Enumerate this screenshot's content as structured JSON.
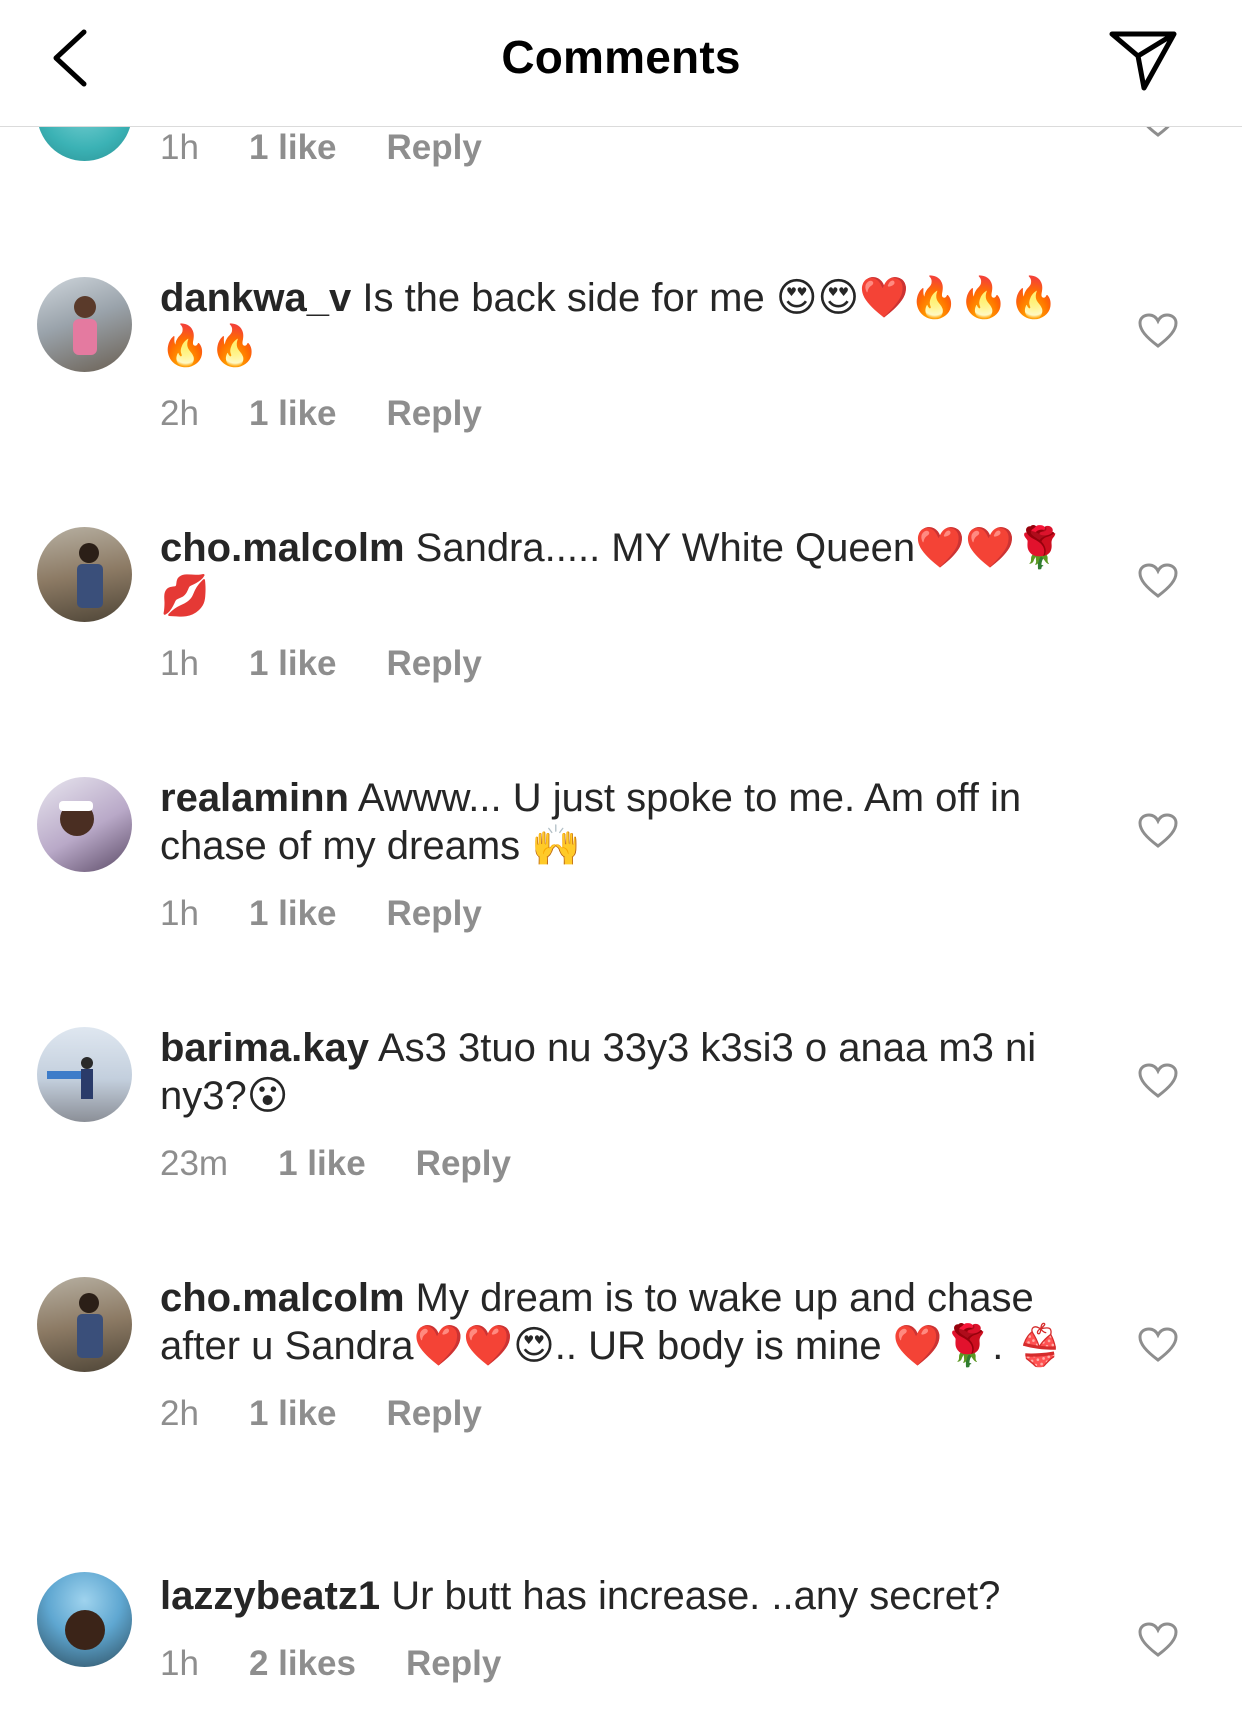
{
  "header": {
    "title": "Comments"
  },
  "comments": [
    {
      "time": "1h",
      "likes": "1 like",
      "reply": "Reply"
    },
    {
      "username": "dankwa_v",
      "text": "Is the back side for me 😍😍❤️🔥🔥🔥🔥🔥",
      "time": "2h",
      "likes": "1 like",
      "reply": "Reply"
    },
    {
      "username": "cho.malcolm",
      "text": "Sandra..... MY White Queen❤️❤️🌹💋",
      "time": "1h",
      "likes": "1 like",
      "reply": "Reply"
    },
    {
      "username": "realaminn",
      "text": "Awww... U just spoke to me. Am off in chase of my dreams 🙌",
      "time": "1h",
      "likes": "1 like",
      "reply": "Reply"
    },
    {
      "username": "barima.kay",
      "text": "As3 3tuo nu 33y3 k3si3 o anaa m3 ni ny3?😮",
      "time": "23m",
      "likes": "1 like",
      "reply": "Reply"
    },
    {
      "username": "cho.malcolm",
      "text": "My dream is to wake up and chase after u Sandra❤️❤️😍.. UR body is mine ❤️🌹. 👙",
      "time": "2h",
      "likes": "1 like",
      "reply": "Reply"
    },
    {
      "username": "lazzybeatz1",
      "text": "Ur butt has increase. ..any secret?",
      "time": "1h",
      "likes": "2 likes",
      "reply": "Reply"
    }
  ]
}
